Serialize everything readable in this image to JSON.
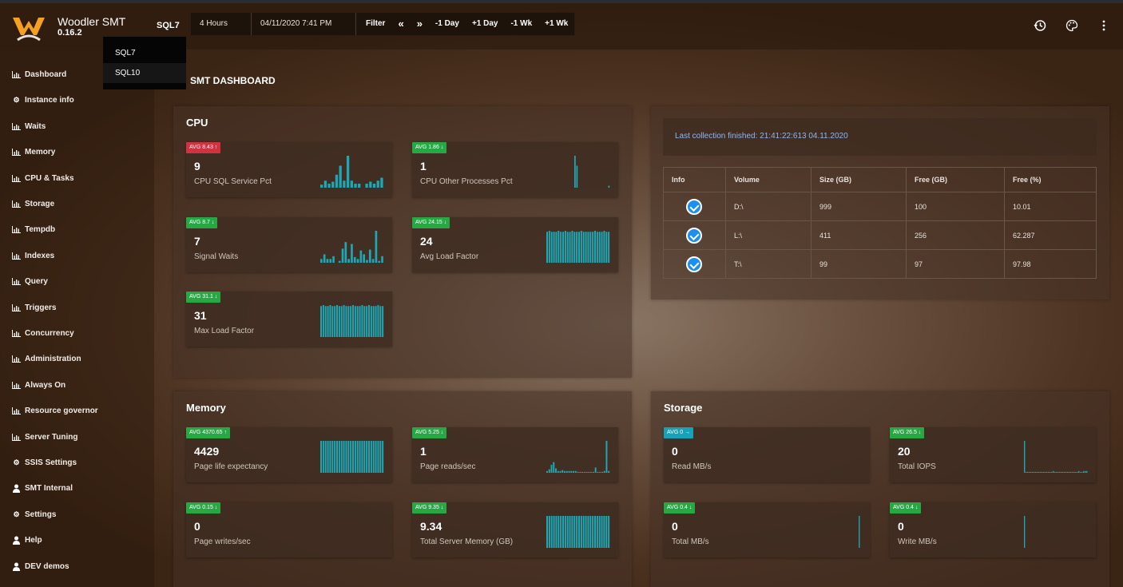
{
  "app": {
    "name": "Woodler SMT",
    "version": "0.16.2"
  },
  "header": {
    "server": "SQL7",
    "range": "4 Hours",
    "datetime": "04/11/2020 7:41 PM",
    "filter": "Filter",
    "prev": "«",
    "next": "»",
    "minus_day": "-1 Day",
    "plus_day": "+1 Day",
    "minus_wk": "-1 Wk",
    "plus_wk": "+1 Wk",
    "icons": [
      "history-icon",
      "palette-icon",
      "more-vert-icon"
    ]
  },
  "dropdown": {
    "options": [
      "SQL7",
      "SQL10"
    ]
  },
  "sidebar": {
    "items": [
      {
        "label": "Dashboard",
        "icon": "chart-icon"
      },
      {
        "label": "Instance info",
        "icon": "gear-icon"
      },
      {
        "label": "Waits",
        "icon": "chart-icon"
      },
      {
        "label": "Memory",
        "icon": "chart-icon"
      },
      {
        "label": "CPU & Tasks",
        "icon": "chart-icon"
      },
      {
        "label": "Storage",
        "icon": "chart-icon"
      },
      {
        "label": "Tempdb",
        "icon": "chart-icon"
      },
      {
        "label": "Indexes",
        "icon": "chart-icon"
      },
      {
        "label": "Query",
        "icon": "chart-icon"
      },
      {
        "label": "Triggers",
        "icon": "chart-icon"
      },
      {
        "label": "Concurrency",
        "icon": "chart-icon"
      },
      {
        "label": "Administration",
        "icon": "chart-icon"
      },
      {
        "label": "Always On",
        "icon": "chart-icon"
      },
      {
        "label": "Resource governor",
        "icon": "chart-icon"
      },
      {
        "label": "Server Tuning",
        "icon": "chart-icon"
      },
      {
        "label": "SSIS Settings",
        "icon": "gears-icon"
      },
      {
        "label": "SMT Internal",
        "icon": "user-icon"
      },
      {
        "label": "Settings",
        "icon": "gears-icon"
      },
      {
        "label": "Help",
        "icon": "user-icon"
      },
      {
        "label": "DEV demos",
        "icon": "user-icon"
      }
    ]
  },
  "main": {
    "title": "SMT DASHBOARD",
    "cpu": {
      "title": "CPU",
      "cards": [
        {
          "badge": "AVG 8.43",
          "trend": "up",
          "color": "red",
          "value": "9",
          "label": "CPU SQL Service Pct",
          "spark": [
            3,
            7,
            4,
            6,
            13,
            22,
            7,
            32,
            7,
            4,
            4,
            0,
            4,
            6,
            4,
            7,
            10
          ]
        },
        {
          "badge": "AVG 1.86",
          "trend": "down",
          "color": "green",
          "value": "1",
          "label": "CPU Other Processes Pct",
          "spark": [
            0,
            0,
            0,
            0,
            0,
            0,
            0,
            0,
            0,
            0,
            0,
            0,
            0,
            0,
            32,
            22,
            0,
            0,
            0,
            0,
            0,
            0,
            0,
            0,
            0,
            0,
            0,
            0,
            0,
            0,
            0,
            2
          ]
        },
        {
          "badge": "AVG 8.7",
          "trend": "down",
          "color": "green",
          "value": "7",
          "label": "Signal Waits",
          "spark": [
            4,
            9,
            4,
            4,
            7,
            0,
            2,
            15,
            22,
            4,
            20,
            6,
            4,
            13,
            9,
            3,
            14,
            4,
            34,
            2,
            7
          ]
        },
        {
          "badge": "AVG 24.15",
          "trend": "down",
          "color": "green",
          "value": "24",
          "label": "Avg Load Factor",
          "spark": [
            31,
            32,
            31,
            31,
            31,
            32,
            31,
            31,
            32,
            31,
            31,
            32,
            31,
            31,
            31,
            32,
            31,
            31,
            31,
            31,
            31,
            32,
            31,
            31,
            31,
            32,
            31,
            31
          ]
        },
        {
          "badge": "AVG 31.1",
          "trend": "down",
          "color": "green",
          "value": "31",
          "label": "Max Load Factor",
          "spark": [
            32,
            33,
            32,
            32,
            33,
            32,
            32,
            33,
            32,
            32,
            33,
            32,
            32,
            32,
            33,
            32,
            32,
            32,
            33,
            32,
            32,
            33,
            32,
            32,
            32,
            33,
            32,
            32
          ]
        }
      ]
    },
    "memory": {
      "title": "Memory",
      "cards": [
        {
          "badge": "AVG 4370.65",
          "trend": "up",
          "color": "green",
          "value": "4429",
          "label": "Page life expectancy",
          "spark": [
            33,
            33,
            33,
            33,
            33,
            33,
            33,
            33,
            33,
            33,
            33,
            33,
            33,
            33,
            33,
            33,
            33,
            33,
            33,
            33,
            33,
            33,
            33,
            33,
            33,
            33,
            33,
            33
          ]
        },
        {
          "badge": "AVG 5.25",
          "trend": "down",
          "color": "green",
          "value": "1",
          "label": "Page reads/sec",
          "spark": [
            2,
            4,
            9,
            12,
            5,
            2,
            2,
            3,
            2,
            2,
            2,
            2,
            2,
            2,
            1,
            1,
            1,
            1,
            1,
            1,
            1,
            1,
            6,
            1,
            1,
            1,
            2,
            36,
            2
          ]
        },
        {
          "badge": "AVG 0.15",
          "trend": "down",
          "color": "green",
          "value": "0",
          "label": "Page writes/sec",
          "spark": [
            0,
            0,
            0,
            0,
            0,
            0,
            0,
            0,
            0,
            0,
            0,
            0,
            0,
            0,
            0,
            0,
            0,
            0,
            0,
            0,
            0,
            0,
            0,
            0,
            0,
            0,
            0,
            0,
            0,
            0,
            0,
            0,
            0,
            0,
            0,
            0,
            0,
            0,
            0,
            0,
            0,
            0,
            0,
            0,
            0,
            0,
            0,
            0,
            0,
            0,
            0,
            0,
            0,
            0,
            0,
            0,
            0,
            0,
            0,
            0,
            0,
            0,
            0,
            0,
            0,
            0,
            0,
            0,
            0,
            0,
            0,
            0,
            0,
            0,
            0,
            0,
            0,
            0,
            0,
            0
          ]
        },
        {
          "badge": "AVG 9.35",
          "trend": "down",
          "color": "green",
          "value": "9.34",
          "label": "Total Server Memory (GB)",
          "spark": [
            35,
            35,
            35,
            35,
            35,
            35,
            35,
            35,
            35,
            35,
            35,
            35,
            35,
            35,
            35,
            35,
            35,
            35,
            35,
            35,
            35,
            35,
            35,
            35,
            35,
            35,
            35,
            35
          ]
        }
      ]
    },
    "storage": {
      "title": "Storage",
      "cards": [
        {
          "badge": "AVG 0",
          "trend": "right",
          "color": "blue",
          "value": "0",
          "label": "Read MB/s",
          "spark": []
        },
        {
          "badge": "AVG 26.5",
          "trend": "down",
          "color": "green",
          "value": "20",
          "label": "Total IOPS",
          "spark": [
            36,
            1,
            1,
            1,
            1,
            1,
            1,
            1,
            1,
            1,
            1,
            1,
            1,
            1,
            1,
            1,
            1,
            1,
            2,
            1,
            1,
            1,
            1,
            1,
            1,
            1,
            1,
            1,
            1,
            1,
            1,
            1,
            1,
            1,
            2,
            1,
            1,
            2,
            2,
            2
          ]
        },
        {
          "badge": "AVG 0.4",
          "trend": "down",
          "color": "green",
          "value": "0",
          "label": "Total MB/s",
          "spark": [
            0,
            0,
            0,
            0,
            0,
            0,
            0,
            0,
            0,
            0,
            0,
            0,
            0,
            0,
            0,
            0,
            0,
            0,
            0,
            0,
            0,
            0,
            0,
            0,
            0,
            0,
            0,
            0,
            0,
            0,
            0,
            0,
            0,
            0,
            0,
            0,
            0,
            0,
            0,
            35,
            0
          ]
        },
        {
          "badge": "AVG 0.4",
          "trend": "down",
          "color": "green",
          "value": "0",
          "label": "Write MB/s",
          "spark": [
            35,
            0,
            0,
            0,
            0,
            0,
            0,
            0,
            0,
            0,
            0,
            0,
            0,
            0,
            0,
            0,
            0,
            0,
            0,
            0,
            0,
            0,
            0,
            0,
            0,
            0,
            0,
            0,
            0,
            0,
            0,
            0,
            0,
            0,
            0,
            0,
            0,
            0,
            0,
            0,
            0
          ]
        }
      ]
    },
    "info": {
      "last_collection": "Last collection finished: 21:41:22:613 04.11.2020",
      "columns": [
        "Info",
        "Volume",
        "Size (GB)",
        "Free (GB)",
        "Free (%)"
      ],
      "rows": [
        {
          "volume": "D:\\",
          "size": "999",
          "free": "100",
          "pct": "10.01"
        },
        {
          "volume": "L:\\",
          "size": "411",
          "free": "256",
          "pct": "62.287"
        },
        {
          "volume": "T:\\",
          "size": "99",
          "free": "97",
          "pct": "97.98"
        }
      ]
    }
  },
  "colors": {
    "bar": "#1ea7b5",
    "badge_red": "#d2323f",
    "badge_green": "#28a845",
    "badge_blue": "#17a2b8"
  }
}
